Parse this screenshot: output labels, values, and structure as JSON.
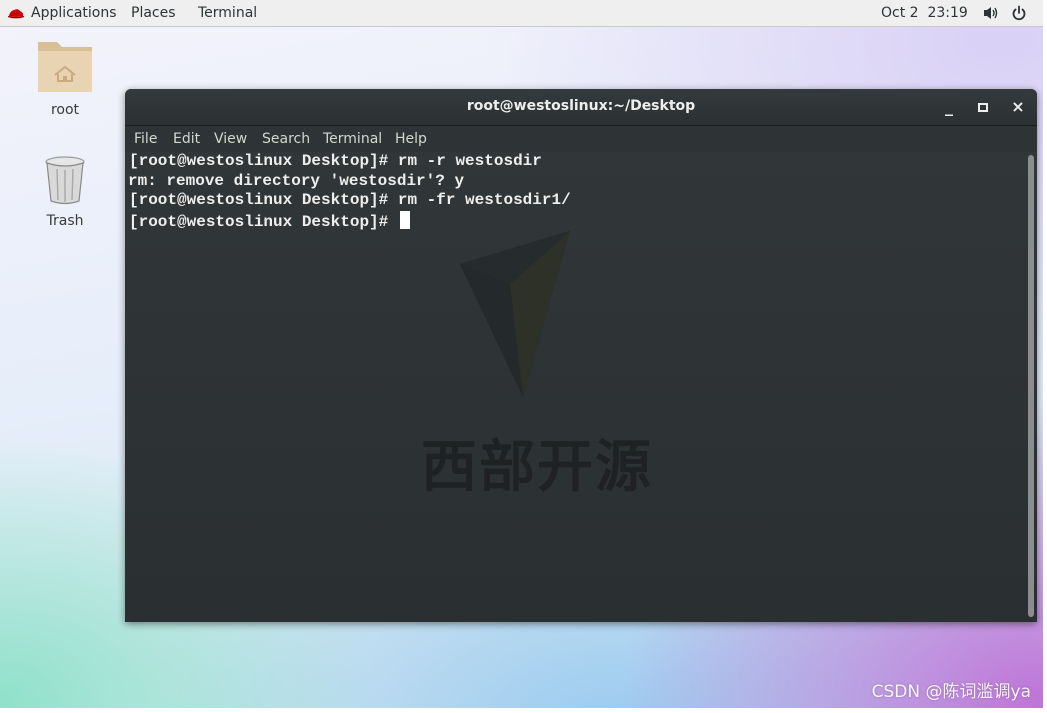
{
  "topbar": {
    "applications": "Applications",
    "places": "Places",
    "terminal": "Terminal",
    "clock": "Oct 2  23:19"
  },
  "desktop": {
    "icons": [
      {
        "label": "root",
        "icon": "home-folder-icon"
      },
      {
        "label": "Trash",
        "icon": "trash-icon"
      }
    ]
  },
  "window": {
    "title": "root@westoslinux:~/Desktop",
    "buttons": {
      "minimize": "_",
      "maximize": "□",
      "close": "×"
    },
    "menu": [
      "File",
      "Edit",
      "View",
      "Search",
      "Terminal",
      "Help"
    ],
    "lines": [
      "[root@westoslinux Desktop]# rm -r westosdir",
      "rm: remove directory 'westosdir'? y",
      "[root@westoslinux Desktop]# rm -fr westosdir1/",
      "[root@westoslinux Desktop]# "
    ]
  },
  "watermark": {
    "logo_text": "西部开源",
    "site": "CSDN @陈词滥调ya"
  },
  "colors": {
    "terminal_bg": "#2e3436",
    "terminal_fg": "#eeeeec",
    "topbar_bg": "#efefef",
    "redhat_red": "#cc0000"
  }
}
